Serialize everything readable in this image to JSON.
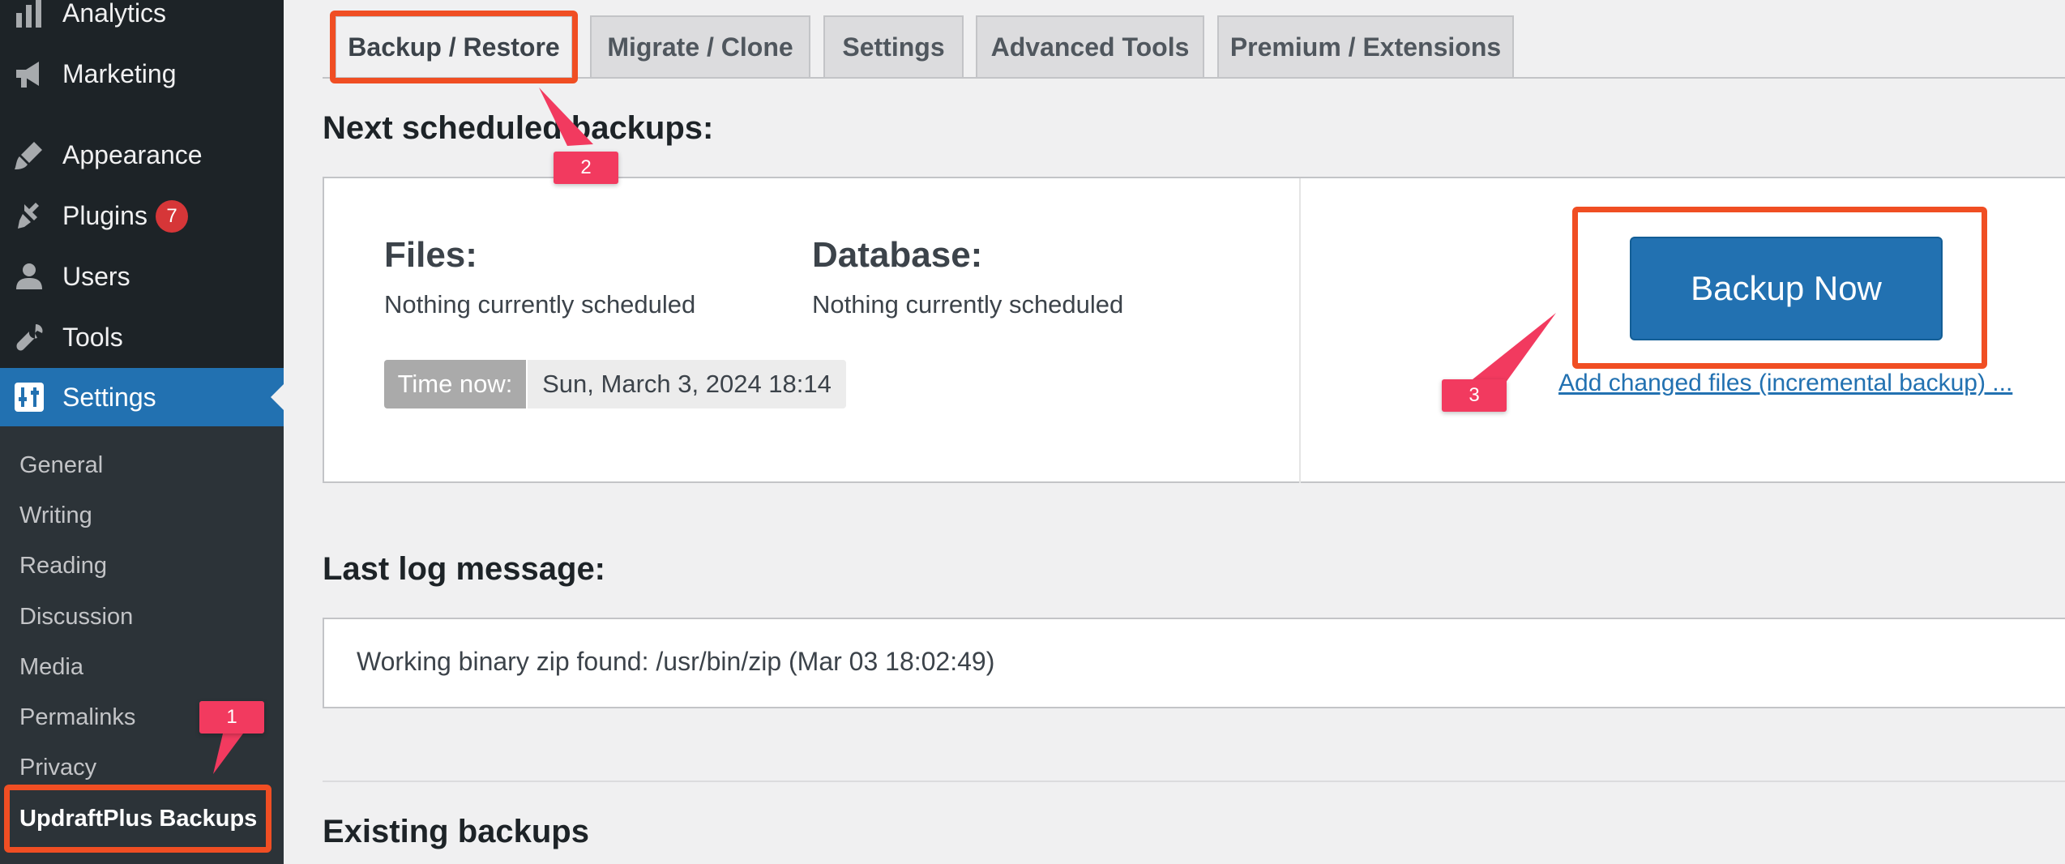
{
  "sidebar": {
    "menu": [
      {
        "label": "Analytics",
        "icon": "bar-chart-icon"
      },
      {
        "label": "Marketing",
        "icon": "megaphone-icon"
      },
      {
        "label": "Appearance",
        "icon": "paintbrush-icon"
      },
      {
        "label": "Plugins",
        "icon": "plugin-icon",
        "badge": "7"
      },
      {
        "label": "Users",
        "icon": "user-icon"
      },
      {
        "label": "Tools",
        "icon": "wrench-icon"
      },
      {
        "label": "Settings",
        "icon": "sliders-icon",
        "current": true
      }
    ],
    "submenu": [
      "General",
      "Writing",
      "Reading",
      "Discussion",
      "Media",
      "Permalinks",
      "Privacy",
      "UpdraftPlus Backups"
    ]
  },
  "tabs": [
    "Backup / Restore",
    "Migrate / Clone",
    "Settings",
    "Advanced Tools",
    "Premium / Extensions"
  ],
  "scheduled": {
    "heading": "Next scheduled backups:",
    "files_title": "Files:",
    "files_text": "Nothing currently scheduled",
    "db_title": "Database:",
    "db_text": "Nothing currently scheduled",
    "time_label": "Time now:",
    "time_value": "Sun, March 3, 2024 18:14",
    "backup_button": "Backup Now",
    "incremental_link": "Add changed files (incremental backup) ..."
  },
  "log": {
    "heading": "Last log message:",
    "message": "Working binary zip found: /usr/bin/zip (Mar 03 18:02:49)"
  },
  "existing": {
    "heading": "Existing backups"
  },
  "annotations": {
    "callouts": [
      "1",
      "2",
      "3"
    ]
  },
  "colors": {
    "sidebar_bg": "#1d2327",
    "submenu_bg": "#2c3338",
    "accent_blue": "#2271b1",
    "badge_red": "#d63638",
    "highlight_orange": "#f04e23",
    "callout_pink": "#f23a5f"
  }
}
